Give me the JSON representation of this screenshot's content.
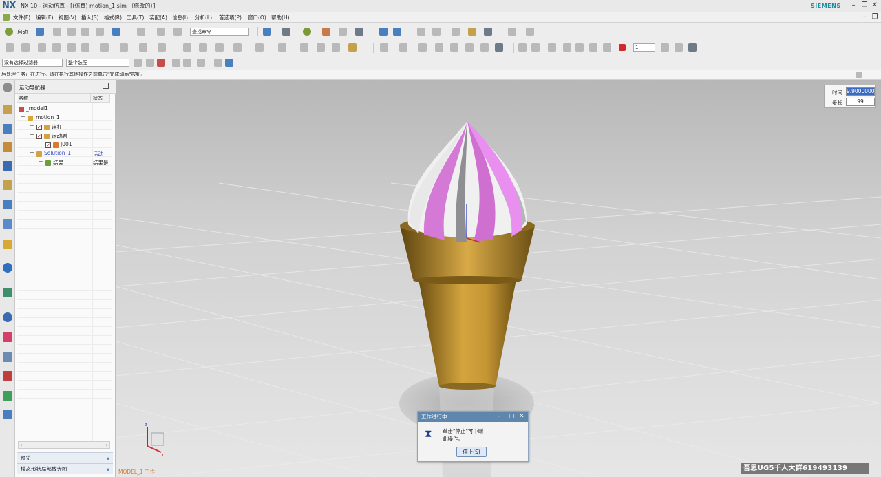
{
  "app": {
    "logo": "NX",
    "title": "NX 10 - 运动仿真 - [(仿真) motion_1.sim （修改的）]",
    "brand": "SIEMENS"
  },
  "menu": [
    "文件(F)",
    "编辑(E)",
    "视图(V)",
    "插入(S)",
    "格式(R)",
    "工具(T)",
    "装配(A)",
    "信息(I)",
    "分析(L)",
    "首选项(P)",
    "窗口(O)",
    "帮助(H)"
  ],
  "toolbar": {
    "start_label": "启动",
    "search_placeholder": "查找命令",
    "filter_value": "没有选择过滤器",
    "assembly_value": "整个装配",
    "step_value": "1"
  },
  "cue_line": "后处理任务正在进行。请在执行其他操作之前单击\"完成动画\"按钮。",
  "navigator": {
    "title": "运动导航器",
    "col_name": "名称",
    "col_status": "状态",
    "items": [
      {
        "label": "_model1",
        "status": "",
        "type": "model"
      },
      {
        "label": "motion_1",
        "status": "",
        "type": "motion"
      },
      {
        "label": "连杆",
        "status": "",
        "type": "links"
      },
      {
        "label": "运动副",
        "status": "",
        "type": "joints"
      },
      {
        "label": "J001",
        "status": "",
        "type": "joint"
      },
      {
        "label": "Solution_1",
        "status": "活动",
        "type": "solution"
      },
      {
        "label": "结果",
        "status": "结果是",
        "type": "results"
      }
    ],
    "accordion": [
      "预览",
      "模态形状局部放大图"
    ]
  },
  "playback": {
    "time_label": "时间",
    "time_value": "9.9000000",
    "step_label": "步长",
    "step_value": "99"
  },
  "dialog": {
    "title": "工作进行中",
    "line1": "单击\"停止\"可中断",
    "line2": "此操作。",
    "button": "停止(S)"
  },
  "viewport": {
    "label": "MODEL_1 工作"
  },
  "watermark": "吾思UG5千人大群619493139",
  "colors": {
    "accent": "#5f87ad",
    "cone": "#c99a3a",
    "cream_pink": "#d67ad8",
    "cream_white": "#f2f2f2"
  }
}
